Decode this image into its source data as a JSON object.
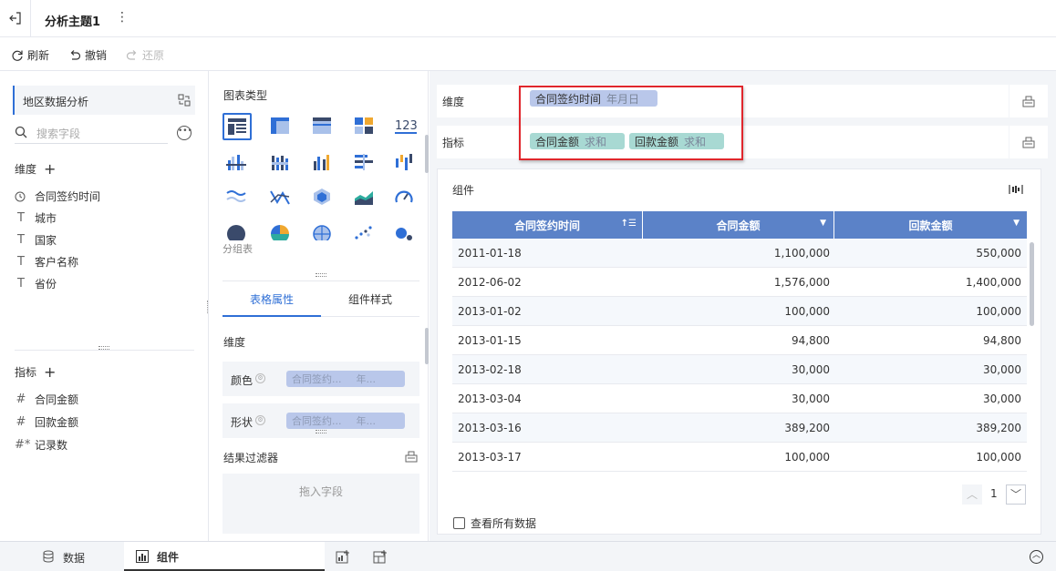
{
  "header": {
    "title": "分析主题1"
  },
  "toolbar": {
    "refresh": "刷新",
    "undo": "撤销",
    "redo": "还原"
  },
  "left": {
    "dataset": "地区数据分析",
    "search_placeholder": "搜索字段",
    "dimension_title": "维度",
    "dimensions": [
      {
        "label": "合同签约时间",
        "icon": "clock-icon"
      },
      {
        "label": "城市",
        "icon": "text-type-icon"
      },
      {
        "label": "国家",
        "icon": "text-type-icon"
      },
      {
        "label": "客户名称",
        "icon": "text-type-icon"
      },
      {
        "label": "省份",
        "icon": "text-type-icon"
      }
    ],
    "measure_title": "指标",
    "measures": [
      {
        "label": "合同金额",
        "icon": "hash-icon"
      },
      {
        "label": "回款金额",
        "icon": "hash-icon"
      },
      {
        "label": "记录数",
        "icon": "hash-star-icon"
      }
    ]
  },
  "middle": {
    "chart_type_title": "图表类型",
    "chart_types": [
      "分组表"
    ],
    "tabs": [
      "表格属性",
      "组件样式"
    ],
    "dimension_title": "维度",
    "color_label": "颜色",
    "shape_label": "形状",
    "color_field": "合同签约...",
    "color_sub": "年...",
    "shape_field": "合同签约...",
    "shape_sub": "年...",
    "filter_title": "结果过滤器",
    "drop_hint": "拖入字段"
  },
  "right": {
    "dim_label": "维度",
    "measure_label": "指标",
    "dim_pill": {
      "field": "合同签约时间",
      "agg": "年月日"
    },
    "measure_pills": [
      {
        "field": "合同金额",
        "agg": "求和"
      },
      {
        "field": "回款金额",
        "agg": "求和"
      }
    ],
    "component_title": "组件",
    "table": {
      "columns": [
        "合同签约时间",
        "合同金额",
        "回款金额"
      ],
      "rows": [
        [
          "2011-01-18",
          "1,100,000",
          "550,000"
        ],
        [
          "2012-06-02",
          "1,576,000",
          "1,400,000"
        ],
        [
          "2013-01-02",
          "100,000",
          "100,000"
        ],
        [
          "2013-01-15",
          "94,800",
          "94,800"
        ],
        [
          "2013-02-18",
          "30,000",
          "30,000"
        ],
        [
          "2013-03-04",
          "30,000",
          "30,000"
        ],
        [
          "2013-03-16",
          "389,200",
          "389,200"
        ],
        [
          "2013-03-17",
          "100,000",
          "100,000"
        ]
      ]
    },
    "page": "1",
    "view_all": "查看所有数据"
  },
  "bottom": {
    "tabs": [
      "数据",
      "组件"
    ],
    "active_tab": "组件"
  },
  "colors": {
    "accent": "#2f6fd6",
    "header": "#5b82c8",
    "highlight": "#e0262c",
    "dim_pill": "#b9c7ea",
    "measure_pill": "#a8d9d3"
  }
}
